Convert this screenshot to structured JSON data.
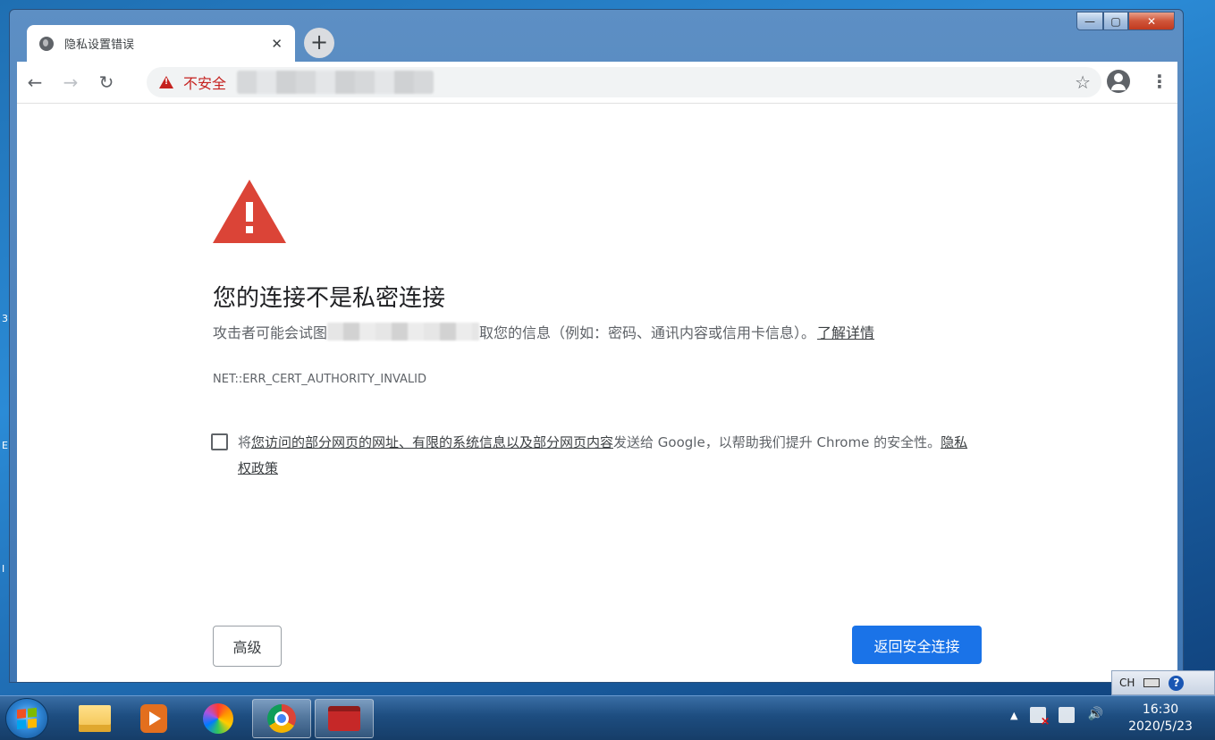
{
  "desktop": {
    "edge_fragments": [
      "3",
      "E",
      "I"
    ]
  },
  "window": {
    "controls": {
      "minimize": "—",
      "maximize": "▢",
      "close": "✕"
    }
  },
  "tab": {
    "title": "隐私设置错误",
    "close": "✕"
  },
  "new_tab": "+",
  "toolbar": {
    "back": "←",
    "forward": "→",
    "reload": "↻",
    "security_label": "不安全",
    "bookmark": "☆",
    "menu": "⋮"
  },
  "page": {
    "heading": "您的连接不是私密连接",
    "desc_before": "攻击者可能会试图",
    "desc_after": "取您的信息（例如：密码、通讯内容或信用卡信息）。",
    "learn_more": "了解详情",
    "error_code": "NET::ERR_CERT_AUTHORITY_INVALID",
    "checkbox_pre": "将",
    "checkbox_link": "您访问的部分网页的网址、有限的系统信息以及部分网页内容",
    "checkbox_post": "发送给 Google，以帮助我们提升 Chrome 的安全性。",
    "privacy_link": "隐私权政策",
    "advanced_button": "高级",
    "back_button": "返回安全连接"
  },
  "language_bar": {
    "lang": "CH",
    "help": "?"
  },
  "taskbar": {
    "apps": [
      "folder-icon",
      "media-player-icon",
      "pinwheel-icon",
      "chrome-icon",
      "toolbox-icon"
    ],
    "tray_arrow": "▲",
    "time": "16:30",
    "date": "2020/5/23"
  },
  "colors": {
    "danger": "#db4437",
    "insecure_text": "#c5221f",
    "primary_button": "#1a73e8"
  }
}
